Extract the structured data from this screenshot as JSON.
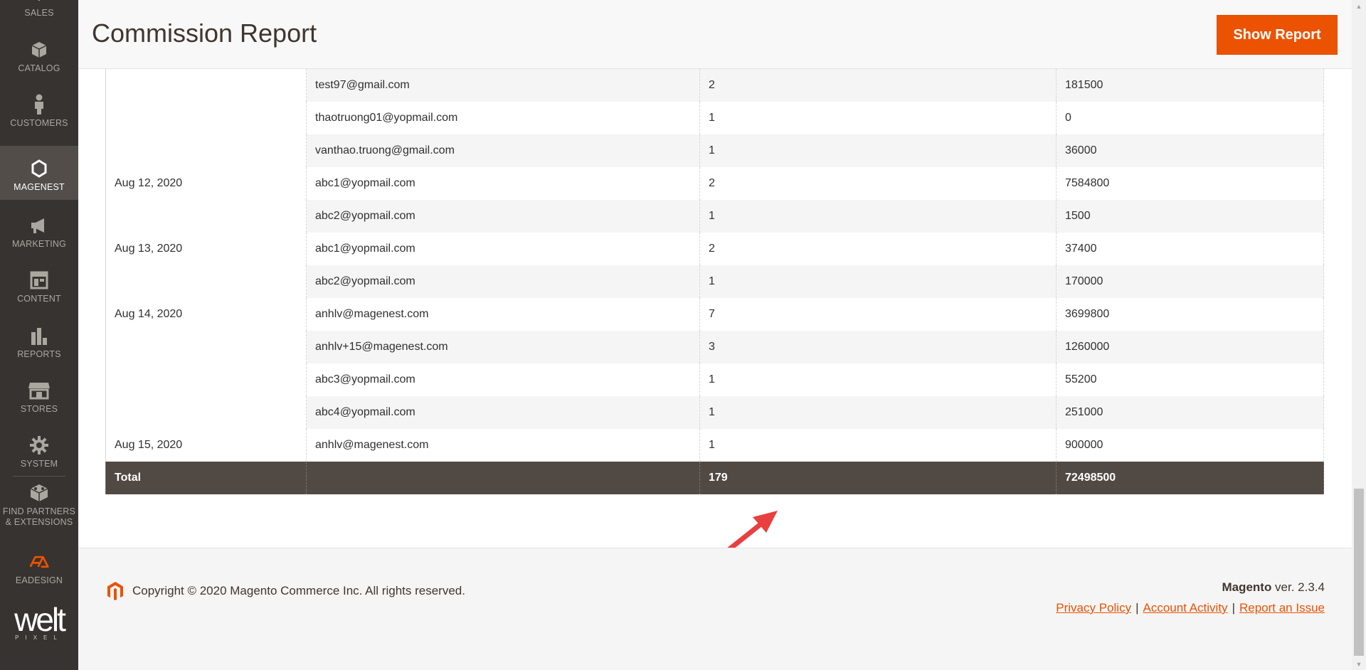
{
  "sidebar": {
    "items": [
      {
        "label": "SALES",
        "icon": "dollar-icon"
      },
      {
        "label": "CATALOG",
        "icon": "cube-icon"
      },
      {
        "label": "CUSTOMERS",
        "icon": "person-icon"
      },
      {
        "label": "MAGENEST",
        "icon": "hexagon-icon"
      },
      {
        "label": "MARKETING",
        "icon": "megaphone-icon"
      },
      {
        "label": "CONTENT",
        "icon": "layout-icon"
      },
      {
        "label": "REPORTS",
        "icon": "bar-chart-icon"
      },
      {
        "label": "STORES",
        "icon": "storefront-icon"
      },
      {
        "label": "SYSTEM",
        "icon": "gear-icon"
      },
      {
        "label": "FIND PARTNERS & EXTENSIONS",
        "icon": "blocks-icon"
      },
      {
        "label": "EADESIGN",
        "icon": "eadesign-logo-icon"
      }
    ],
    "active": "MAGENEST",
    "brand": {
      "big": "welt",
      "small": "PIXEL"
    }
  },
  "header": {
    "title": "Commission Report",
    "show_report_label": "Show Report"
  },
  "table": {
    "rows": [
      {
        "date": "",
        "email": "test97@gmail.com",
        "orders": "2",
        "amount": "181500"
      },
      {
        "date": "",
        "email": "thaotruong01@yopmail.com",
        "orders": "1",
        "amount": "0"
      },
      {
        "date": "",
        "email": "vanthao.truong@gmail.com",
        "orders": "1",
        "amount": "36000"
      },
      {
        "date": "Aug 12, 2020",
        "email": "abc1@yopmail.com",
        "orders": "2",
        "amount": "7584800"
      },
      {
        "date": "",
        "email": "abc2@yopmail.com",
        "orders": "1",
        "amount": "1500"
      },
      {
        "date": "Aug 13, 2020",
        "email": "abc1@yopmail.com",
        "orders": "2",
        "amount": "37400"
      },
      {
        "date": "",
        "email": "abc2@yopmail.com",
        "orders": "1",
        "amount": "170000"
      },
      {
        "date": "Aug 14, 2020",
        "email": "anhlv@magenest.com",
        "orders": "7",
        "amount": "3699800"
      },
      {
        "date": "",
        "email": "anhlv+15@magenest.com",
        "orders": "3",
        "amount": "1260000"
      },
      {
        "date": "",
        "email": "abc3@yopmail.com",
        "orders": "1",
        "amount": "55200"
      },
      {
        "date": "",
        "email": "abc4@yopmail.com",
        "orders": "1",
        "amount": "251000"
      },
      {
        "date": "Aug 15, 2020",
        "email": "anhlv@magenest.com",
        "orders": "1",
        "amount": "900000"
      }
    ],
    "total": {
      "label": "Total",
      "email": "",
      "orders": "179",
      "amount": "72498500"
    }
  },
  "footer": {
    "copyright": "Copyright © 2020 Magento Commerce Inc. All rights reserved.",
    "brand": "Magento",
    "version": " ver. 2.3.4",
    "links": [
      "Privacy Policy",
      "Account Activity",
      "Report an Issue"
    ],
    "separator": "|"
  },
  "colors": {
    "sidebar_bg": "#373330",
    "accent": "#eb5202",
    "total_row_bg": "#514943",
    "arrow": "#e8403f"
  }
}
